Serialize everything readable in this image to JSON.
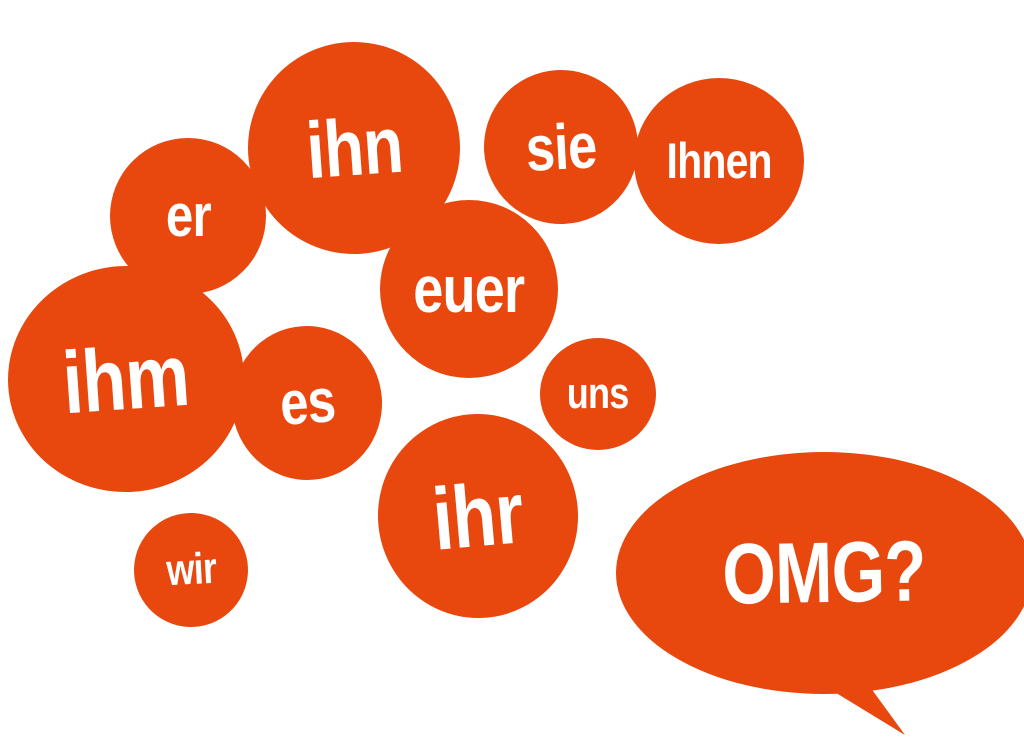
{
  "colors": {
    "bubble_fill": "#e8470e",
    "text": "#ffffff",
    "background": "#ffffff"
  },
  "words": {
    "er": "er",
    "ihn": "ihn",
    "sie": "sie",
    "ihnen": "Ihnen",
    "euer": "euer",
    "ihm": "ihm",
    "es": "es",
    "uns": "uns",
    "ihr": "ihr",
    "wir": "wir"
  },
  "speech_bubble": {
    "label": "OMG?"
  }
}
